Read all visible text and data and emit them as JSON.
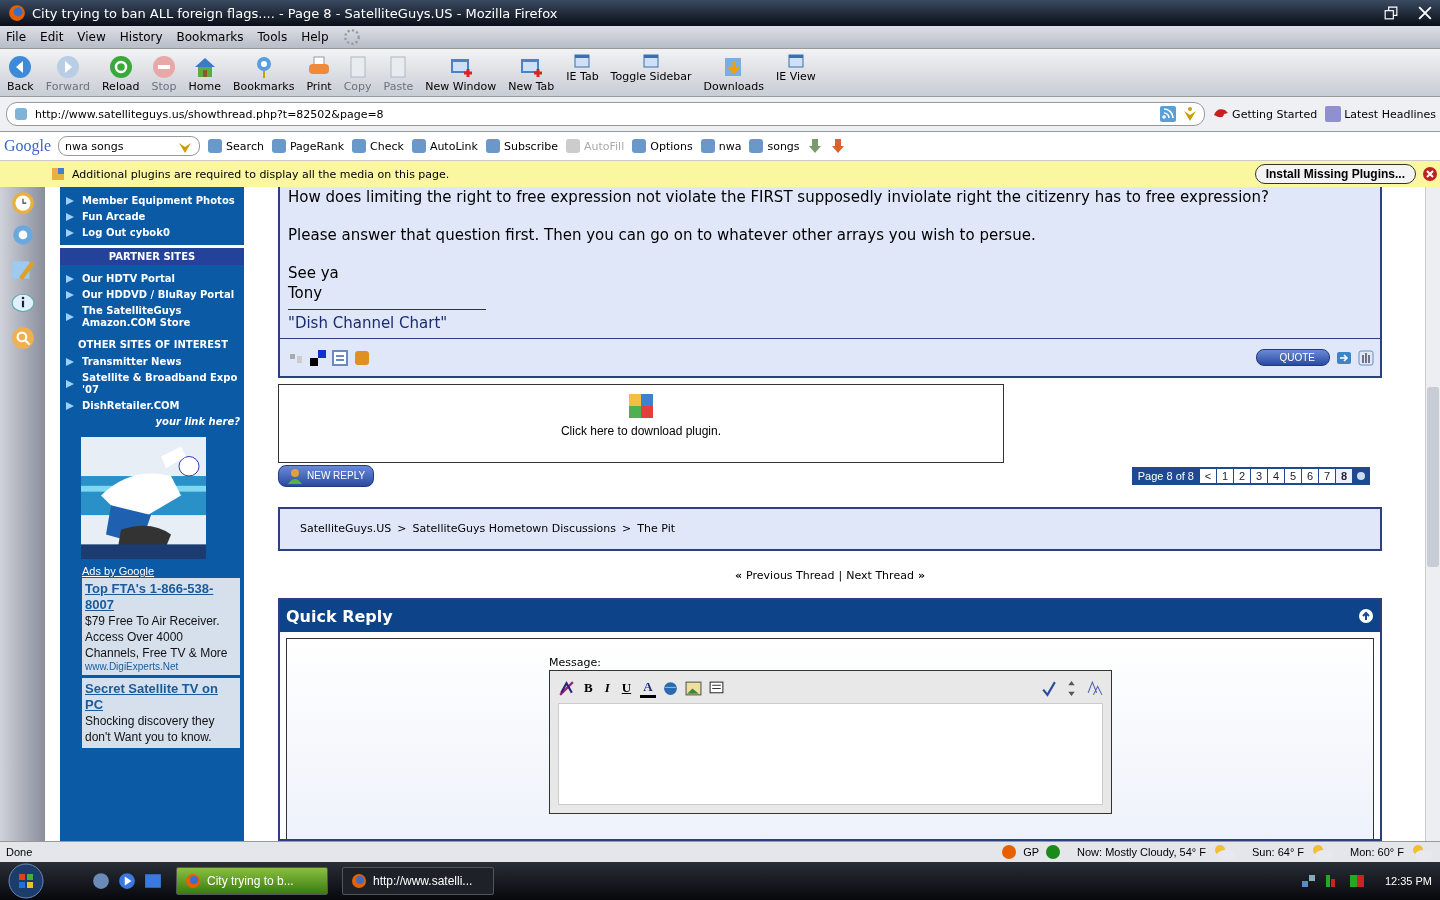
{
  "window": {
    "title": "City trying to ban ALL foreign flags.... - Page 8 - SatelliteGuys.US - Mozilla Firefox"
  },
  "menu": [
    "File",
    "Edit",
    "View",
    "History",
    "Bookmarks",
    "Tools",
    "Help"
  ],
  "toolbar": [
    {
      "label": "Back",
      "kind": "back",
      "disabled": false
    },
    {
      "label": "Forward",
      "kind": "forward",
      "disabled": true
    },
    {
      "label": "Reload",
      "kind": "reload",
      "disabled": false
    },
    {
      "label": "Stop",
      "kind": "stop",
      "disabled": true
    },
    {
      "label": "Home",
      "kind": "home",
      "disabled": false
    },
    {
      "label": "Bookmarks",
      "kind": "star",
      "disabled": false
    },
    {
      "label": "Print",
      "kind": "printer",
      "disabled": false
    },
    {
      "label": "Copy",
      "kind": "document",
      "disabled": true
    },
    {
      "label": "Paste",
      "kind": "document",
      "disabled": true
    },
    {
      "label": "New Window",
      "kind": "window",
      "disabled": false
    },
    {
      "label": "New Tab",
      "kind": "window",
      "disabled": false
    },
    {
      "label": "IE Tab",
      "kind": "small",
      "disabled": false
    },
    {
      "label": "Toggle Sidebar",
      "kind": "small",
      "disabled": false
    },
    {
      "label": "Downloads",
      "kind": "download",
      "disabled": false
    },
    {
      "label": "IE View",
      "kind": "small",
      "disabled": false
    }
  ],
  "address": {
    "url": "http://www.satelliteguys.us/showthread.php?t=82502&page=8"
  },
  "bookmarks": [
    "Getting Started",
    "Latest Headlines"
  ],
  "google_toolbar": {
    "logo": "Google",
    "query": "nwa songs",
    "items": [
      {
        "label": "Search",
        "disabled": false
      },
      {
        "label": "PageRank",
        "disabled": false
      },
      {
        "label": "Check",
        "disabled": false
      },
      {
        "label": "AutoLink",
        "disabled": false
      },
      {
        "label": "Subscribe",
        "disabled": false
      },
      {
        "label": "AutoFill",
        "disabled": true
      },
      {
        "label": "Options",
        "disabled": false
      },
      {
        "label": "nwa",
        "disabled": false
      },
      {
        "label": "songs",
        "disabled": false
      }
    ]
  },
  "plugin_bar": {
    "message": "Additional plugins are required to display all the media on this page.",
    "button": "Install Missing Plugins..."
  },
  "site_sidebar": {
    "links": [
      "Member Equipment Photos",
      "Fun Arcade",
      "Log Out cybok0"
    ],
    "partner_title": "PARTNER SITES",
    "partner_links": [
      "Our HDTV Portal",
      "Our HDDVD / BluRay Portal",
      "The SatelliteGuys Amazon.COM Store"
    ],
    "other_title": "OTHER SITES OF INTEREST",
    "other_links": [
      "Transmitter News",
      "Satellite & Broadband Expo '07",
      "DishRetailer.COM"
    ],
    "your_link": "your link here?",
    "ads_label": "Ads by Google",
    "ads": [
      {
        "title": "Top FTA's 1-866-538-8007",
        "body": "$79 Free To Air Receiver. Access Over 4000 Channels, Free TV & More",
        "url": "www.DigiExperts.Net"
      },
      {
        "title": "Secret Satellite TV on PC",
        "body": "Shocking discovery they don't Want you to know."
      }
    ]
  },
  "post": {
    "paragraphs": [
      "How does limiting the right to free expression not violate the FIRST supposedly inviolate right the citizenry has to free expression?",
      "Please answer that question first. Then you can go on to whatever other arrays you wish to persue.",
      "See ya\nTony"
    ],
    "signature": "\"Dish Channel Chart\"",
    "quote_button": "QUOTE"
  },
  "plugin_box": {
    "text": "Click here to download plugin."
  },
  "new_reply": "NEW REPLY",
  "pagination": {
    "label": "Page 8 of 8",
    "prev": "<",
    "pages": [
      {
        "label": "1",
        "selected": false
      },
      {
        "label": "2",
        "selected": false
      },
      {
        "label": "3",
        "selected": false
      },
      {
        "label": "4",
        "selected": false
      },
      {
        "label": "5",
        "selected": false
      },
      {
        "label": "6",
        "selected": false
      },
      {
        "label": "7",
        "selected": false
      },
      {
        "label": "8",
        "selected": true
      }
    ]
  },
  "breadcrumb": {
    "separator": ">",
    "items": [
      "SatelliteGuys.US",
      "SatelliteGuys Hometown Discussions",
      "The Pit"
    ]
  },
  "thread_nav": {
    "prev_mark": "«",
    "previous": "Previous Thread",
    "divider": "|",
    "next": "Next Thread",
    "next_mark": "»"
  },
  "quick_reply": {
    "title": "Quick Reply",
    "message_label": "Message:",
    "format_buttons": [
      "B",
      "I",
      "U",
      "A"
    ]
  },
  "status_bar": {
    "text": "Done",
    "gp": "GP",
    "weather": [
      "Now: Mostly Cloudy, 54° F",
      "Sun: 64° F",
      "Mon: 60° F"
    ]
  },
  "taskbar": {
    "tasks": [
      {
        "label": "City trying to b...",
        "selected": true
      },
      {
        "label": "http://www.satelli...",
        "selected": false
      }
    ],
    "clock": "12:35 PM"
  }
}
